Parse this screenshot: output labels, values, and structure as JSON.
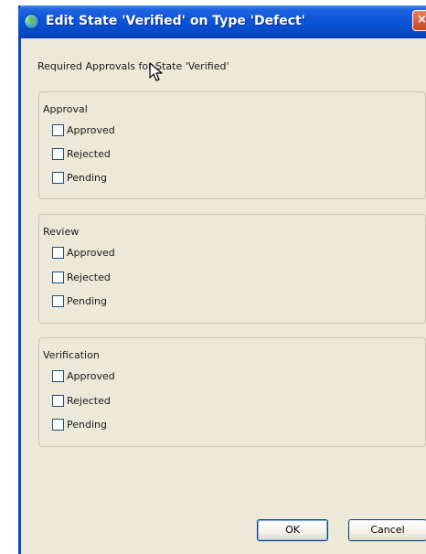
{
  "window": {
    "title": "Edit State 'Verified' on Type 'Defect'",
    "close_glyph": "×"
  },
  "heading": "Required Approvals for State 'Verified'",
  "groups": [
    {
      "label": "Approval",
      "options": [
        "Approved",
        "Rejected",
        "Pending"
      ]
    },
    {
      "label": "Review",
      "options": [
        "Approved",
        "Rejected",
        "Pending"
      ]
    },
    {
      "label": "Verification",
      "options": [
        "Approved",
        "Rejected",
        "Pending"
      ]
    }
  ],
  "buttons": {
    "ok": "OK",
    "cancel": "Cancel"
  },
  "colors": {
    "titlebar": "#0a54d8",
    "dialog_bg": "#ece9d8",
    "close_button": "#d95c33"
  },
  "icons": {
    "app": "globe-icon",
    "close": "close-icon",
    "pointer": "mouse-cursor-icon"
  }
}
